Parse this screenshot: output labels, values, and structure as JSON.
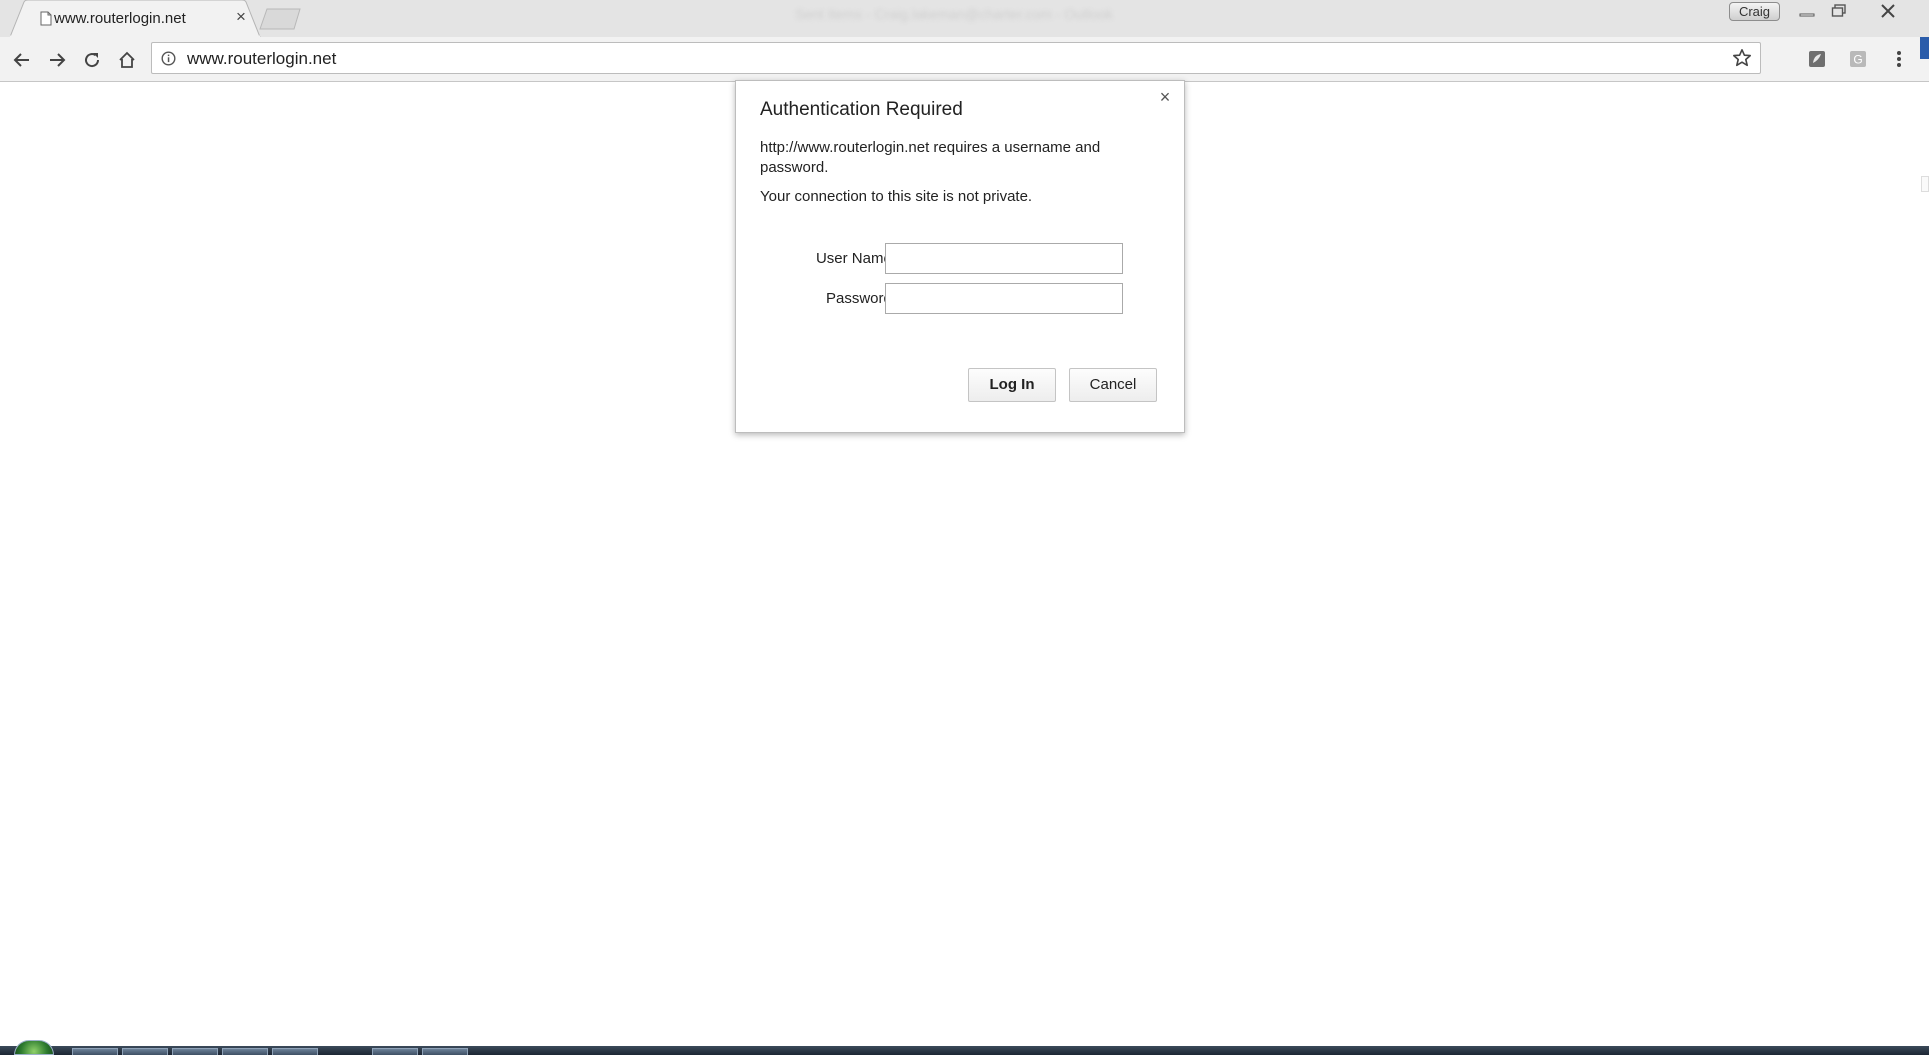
{
  "browser": {
    "tab": {
      "title": "www.routerlogin.net"
    },
    "window_title": "Sent Items - Craig.lakeman@charter.com - Outlook",
    "profile": {
      "name": "Craig"
    },
    "omnibox": {
      "url": "www.routerlogin.net"
    },
    "icons": {
      "favicon": "page-icon",
      "back": "arrow-left-icon",
      "forward": "arrow-right-icon",
      "reload": "reload-icon",
      "home": "home-icon",
      "site_info": "info-icon",
      "bookmark": "star-icon",
      "menu": "three-dot-menu-icon"
    }
  },
  "dialog": {
    "title": "Authentication Required",
    "message": "http://www.routerlogin.net requires a username and password.",
    "privacy_message": "Your connection to this site is not private.",
    "username_label": "User Name:",
    "username_value": "",
    "password_label": "Password:",
    "password_value": "",
    "login_label": "Log In",
    "cancel_label": "Cancel",
    "close_glyph": "×"
  },
  "tab_close_glyph": "×",
  "colors": {
    "titlebar": "#e4e4e4",
    "toolbar": "#f2f2f2",
    "taskbar": "#1c2633",
    "accent_blue": "#2a5caa"
  }
}
